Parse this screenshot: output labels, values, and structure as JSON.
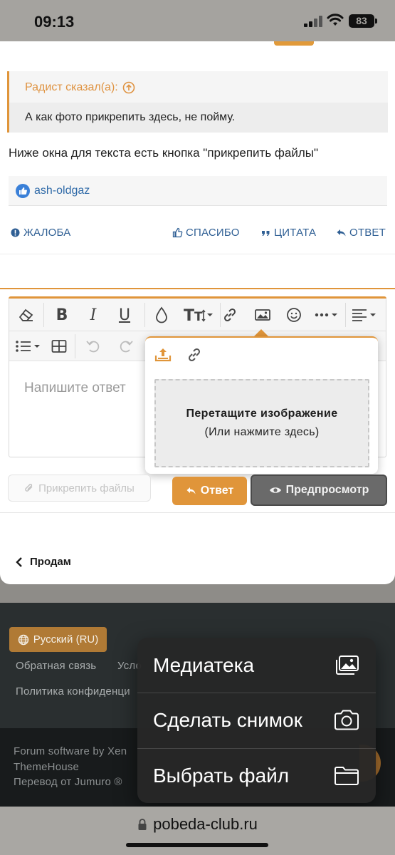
{
  "status_bar": {
    "time": "09:13",
    "battery": "83"
  },
  "quote": {
    "author": "Радист сказал(а):",
    "text": "А как фото прикрепить здесь, не пойму."
  },
  "post": {
    "text": "Ниже окна для текста есть кнопка \"прикрепить файлы\""
  },
  "reactions": {
    "user": "ash-oldgaz"
  },
  "post_actions": {
    "report": "ЖАЛОБА",
    "thanks": "СПАСИБО",
    "quote": "ЦИТАТА",
    "reply": "ОТВЕТ"
  },
  "editor": {
    "placeholder": "Напишите ответ",
    "toolbar_icons": [
      "eraser-icon",
      "bold-icon",
      "italic-icon",
      "underline-icon",
      "text-color-icon",
      "font-size-icon",
      "link-icon",
      "image-icon",
      "emoji-icon",
      "more-icon",
      "align-icon",
      "list-icon",
      "table-icon",
      "undo-icon",
      "redo-icon"
    ],
    "image_popup": {
      "drop_title": "Перетащите изображение",
      "drop_sub": "(Или нажмите здесь)"
    }
  },
  "buttons": {
    "attach": "Прикрепить файлы",
    "reply": "Ответ",
    "preview": "Предпросмотр"
  },
  "back_link": "Продам",
  "footer": {
    "language": "Русский (RU)",
    "feedback": "Обратная связь",
    "terms_partial": "Усло",
    "privacy_partial": "Политика конфиденци",
    "software_partial": "Forum software by Xen",
    "themehouse": "ThemeHouse",
    "translation_partial": "Перевод от Jumuro ®"
  },
  "context_menu": {
    "items": [
      {
        "label": "Медиатека",
        "icon": "photo-library-icon"
      },
      {
        "label": "Сделать снимок",
        "icon": "camera-icon"
      },
      {
        "label": "Выбрать файл",
        "icon": "folder-icon"
      }
    ]
  },
  "browser": {
    "url": "pobeda-club.ru"
  },
  "colors": {
    "accent": "#e0953a",
    "link": "#2f5f94",
    "menu_bg": "#262626"
  }
}
